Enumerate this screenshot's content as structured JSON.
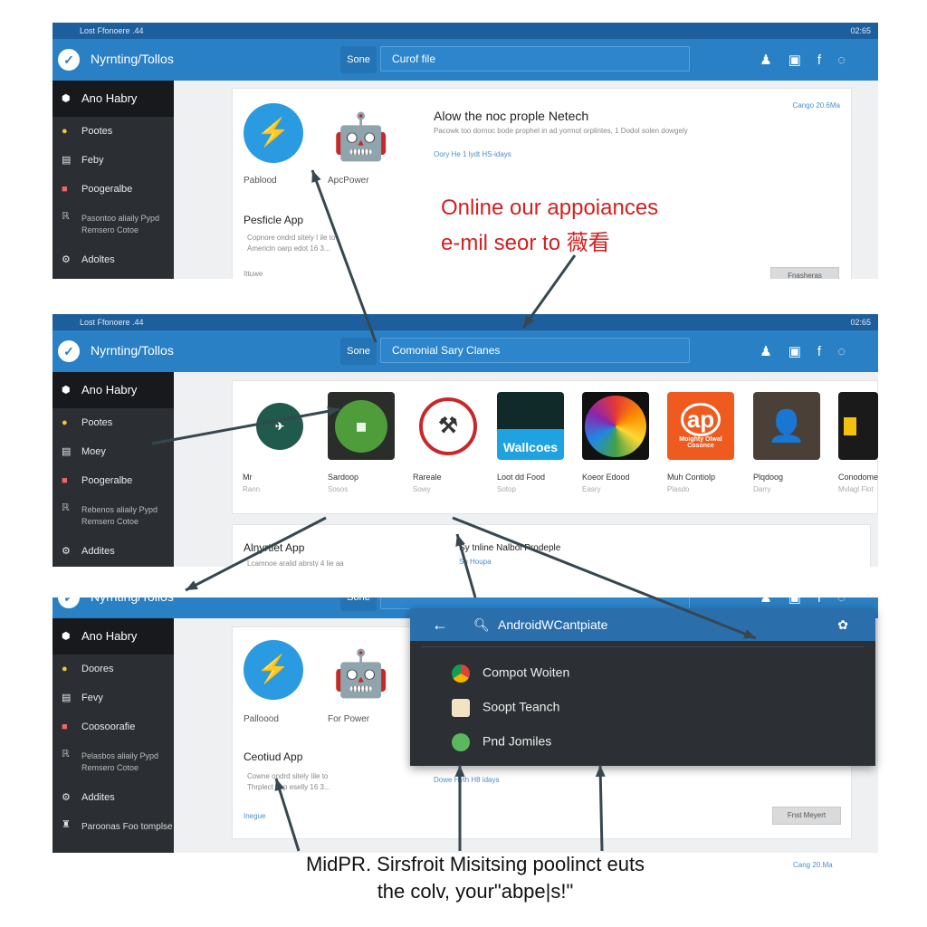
{
  "status": {
    "left": "Lost Ffonoere .44",
    "right": "02:65"
  },
  "header": {
    "title": "Nyrnting/Tollos",
    "scope": "Sone",
    "search_values": [
      "Curof file",
      "Comonial Sary Clanes"
    ]
  },
  "sidebar": {
    "items": [
      "Ano Habry",
      "Pootes",
      "Feby",
      "Poogeralbe",
      "Pasontoo aliaily Pypd Remsero Cotoe",
      "Adoltes"
    ],
    "items_p2": [
      "Ano Habry",
      "Pootes",
      "Moey",
      "Poogeralbe",
      "Rebenos aliaily Pypd Remsero Cotoe",
      "Addites"
    ],
    "items_p3": [
      "Ano Habry",
      "Doores",
      "Fevy",
      "Coosoorafie",
      "Pelasbos aliaily Pypd Remsero Cotoe",
      "Addites",
      "Paroonas Foo tomplse"
    ]
  },
  "panel1": {
    "app1": "Pablood",
    "app2": "ApcPower",
    "heading": "Alow the noc prople Netech",
    "desc": "Pacowk too dornoc bode prophel in ad yormot orplintes, 1 Dodol solen dowgely",
    "link": "Oory He 1 lydt HS-idays",
    "top_link": "Cango 20.6Ma",
    "section": "Pesficle App",
    "bullets": [
      "Copnore ondrd sitely I ile to",
      "Americln oarp edot 16 3..."
    ],
    "more": "Fnasheras",
    "footer_link": "Ittuwe"
  },
  "panel2": {
    "apps": [
      {
        "name": "Mr",
        "sub": "Rann"
      },
      {
        "name": "Sardoop",
        "sub": "Sosos"
      },
      {
        "name": "Rareale",
        "sub": "Sowy"
      },
      {
        "name": "Loot dd Food",
        "sub": "Sotop"
      },
      {
        "name": "Koeor Edood",
        "sub": "Easry"
      },
      {
        "name": "Muh Contiolp",
        "sub": "Plasdo"
      },
      {
        "name": "Plqdoog",
        "sub": "Darry"
      },
      {
        "name": "Conodome",
        "sub": "Mvlagl Flot"
      }
    ],
    "tile_texts": [
      "Wallcoes",
      "ap",
      "Moighty Olwal Cosonce"
    ],
    "section": "Alnyrtlet App",
    "right_title": "Sy tnline Nalbol Prodeple",
    "right_link": "Sh Houpa",
    "bullet": "Lcamnoe aralid abrsty 4 lie aa"
  },
  "panel3": {
    "app1": "Palloood",
    "app2": "For Power",
    "section": "Ceotiud App",
    "bullets": [
      "Cowne ondrd sitely Iile to",
      "Thrplect gap eselly 16 3..."
    ],
    "link": "Dowe Hyth H8 idays",
    "more": "Fnst Meyert",
    "footer_link": "Inegue",
    "bottom_link": "Cang 20.Ma"
  },
  "popup": {
    "search": "AndroidWCantpiate",
    "items": [
      "Compot Woiten",
      "Soopt Teanch",
      "Pnd Jomiles"
    ]
  },
  "annotations": {
    "red": [
      "Online our appoiances",
      "e-mil seor to 薇看"
    ],
    "caption": [
      "MidPR. Sirsfroit Misitsing poolinct euts",
      "the colv, your\"abpe|s!\""
    ]
  },
  "colors": {
    "header": "#2a80c4",
    "status": "#1d5f9c",
    "sidebar": "#2b2f34",
    "annotation": "#d32020",
    "arrow": "#37474f"
  }
}
